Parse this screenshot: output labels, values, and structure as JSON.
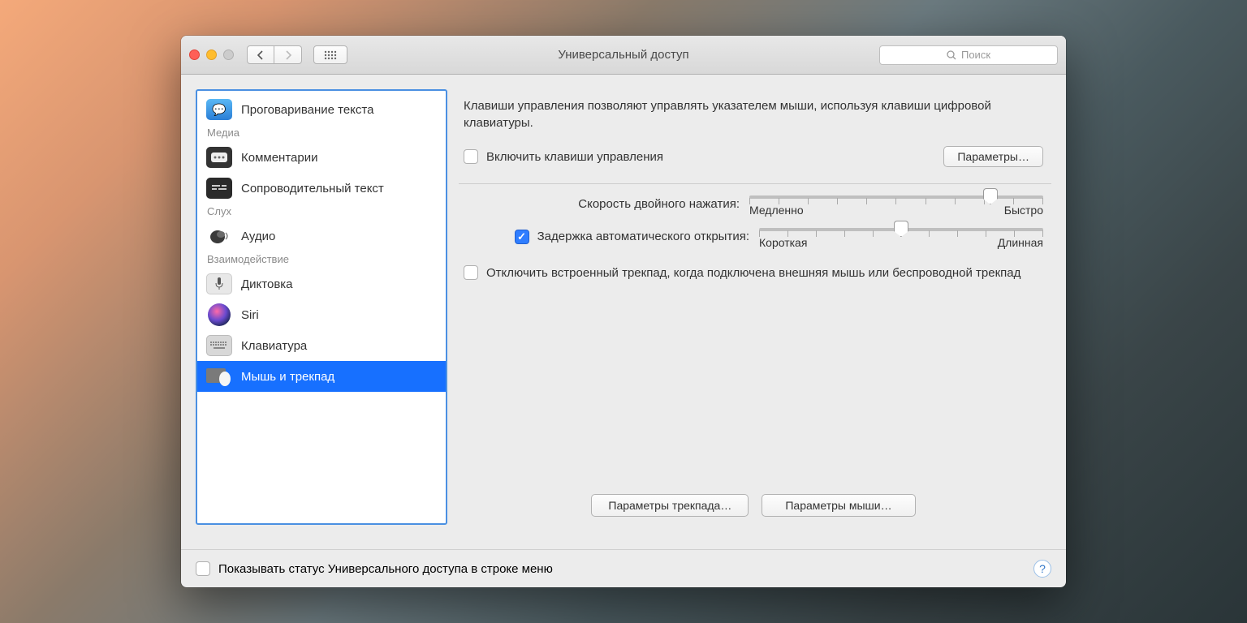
{
  "window_title": "Универсальный доступ",
  "search": {
    "placeholder": "Поиск"
  },
  "sidebar": {
    "items": [
      {
        "label": "Проговаривание текста",
        "section": null
      },
      {
        "label": "Медиа",
        "section": true
      },
      {
        "label": "Комментарии",
        "section": null
      },
      {
        "label": "Сопроводительный текст",
        "section": null
      },
      {
        "label": "Слух",
        "section": true
      },
      {
        "label": "Аудио",
        "section": null
      },
      {
        "label": "Взаимодействие",
        "section": true
      },
      {
        "label": "Диктовка",
        "section": null
      },
      {
        "label": "Siri",
        "section": null
      },
      {
        "label": "Клавиатура",
        "section": null
      },
      {
        "label": "Мышь и трекпад",
        "section": null,
        "selected": true
      }
    ]
  },
  "main": {
    "description": "Клавиши управления позволяют управлять указателем мыши, используя клавиши цифровой клавиатуры.",
    "enable_keys": "Включить клавиши управления",
    "options_button": "Параметры…",
    "slider1": {
      "label": "Скорость двойного нажатия:",
      "min": "Медленно",
      "max": "Быстро",
      "percent": 82
    },
    "delay_check": "Задержка автоматического открытия:",
    "slider2": {
      "min": "Короткая",
      "max": "Длинная",
      "percent": 50
    },
    "disable_trackpad": "Отключить встроенный трекпад, когда подключена внешняя мышь или беспроводной трекпад",
    "trackpad_btn": "Параметры трекпада…",
    "mouse_btn": "Параметры мыши…"
  },
  "footer": {
    "show_status": "Показывать статус Универсального доступа в строке меню"
  }
}
